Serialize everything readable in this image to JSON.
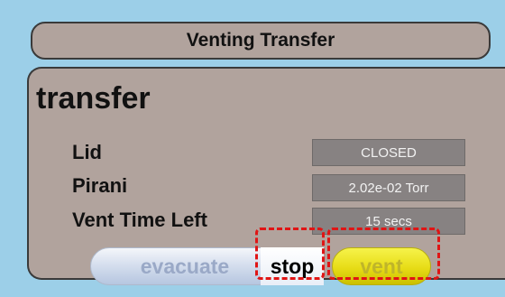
{
  "header": {
    "title": "Venting Transfer"
  },
  "panel": {
    "title": "transfer",
    "rows": [
      {
        "label": "Lid",
        "value": "CLOSED"
      },
      {
        "label": "Pirani",
        "value": "2.02e-02 Torr"
      },
      {
        "label": "Vent Time Left",
        "value": "15 secs"
      }
    ]
  },
  "buttons": {
    "evacuate": "evacuate",
    "stop": "stop",
    "vent": "vent"
  },
  "colors": {
    "background": "#9ccfe8",
    "panel": "#b1a39d",
    "value_box": "#878282",
    "vent_button": "#e7dc16",
    "highlight": "#e01515"
  }
}
